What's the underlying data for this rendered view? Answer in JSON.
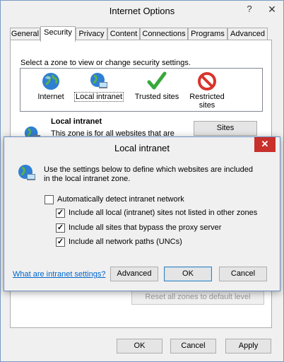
{
  "window": {
    "title": "Internet Options",
    "help_glyph": "?",
    "close_glyph": "✕"
  },
  "tabs": [
    {
      "label": "General"
    },
    {
      "label": "Security"
    },
    {
      "label": "Privacy"
    },
    {
      "label": "Content"
    },
    {
      "label": "Connections"
    },
    {
      "label": "Programs"
    },
    {
      "label": "Advanced"
    }
  ],
  "security": {
    "prompt": "Select a zone to view or change security settings.",
    "zones": [
      {
        "label": "Internet",
        "icon": "globe-icon"
      },
      {
        "label": "Local intranet",
        "icon": "intranet-icon"
      },
      {
        "label": "Trusted sites",
        "icon": "checkmark-icon"
      },
      {
        "label": "Restricted sites",
        "icon": "restricted-icon"
      }
    ],
    "zone_name": "Local intranet",
    "zone_desc": "This zone is for all websites that are",
    "sites_button": "Sites",
    "reset_button": "Reset all zones to default level"
  },
  "footer": {
    "ok": "OK",
    "cancel": "Cancel",
    "apply": "Apply"
  },
  "dialog": {
    "title": "Local intranet",
    "close_glyph": "✕",
    "description": "Use the settings below to define which websites are included in the local intranet zone.",
    "checkboxes": [
      {
        "label": "Automatically detect intranet network",
        "checked": false
      },
      {
        "label": "Include all local (intranet) sites not listed in other zones",
        "checked": true
      },
      {
        "label": "Include all sites that bypass the proxy server",
        "checked": true
      },
      {
        "label": "Include all network paths (UNCs)",
        "checked": true
      }
    ],
    "link": "What are intranet settings?",
    "advanced": "Advanced",
    "ok": "OK",
    "cancel": "Cancel"
  },
  "colors": {
    "accent": "#3c7fb1",
    "close_red": "#c7302b",
    "link": "#0066cc"
  }
}
